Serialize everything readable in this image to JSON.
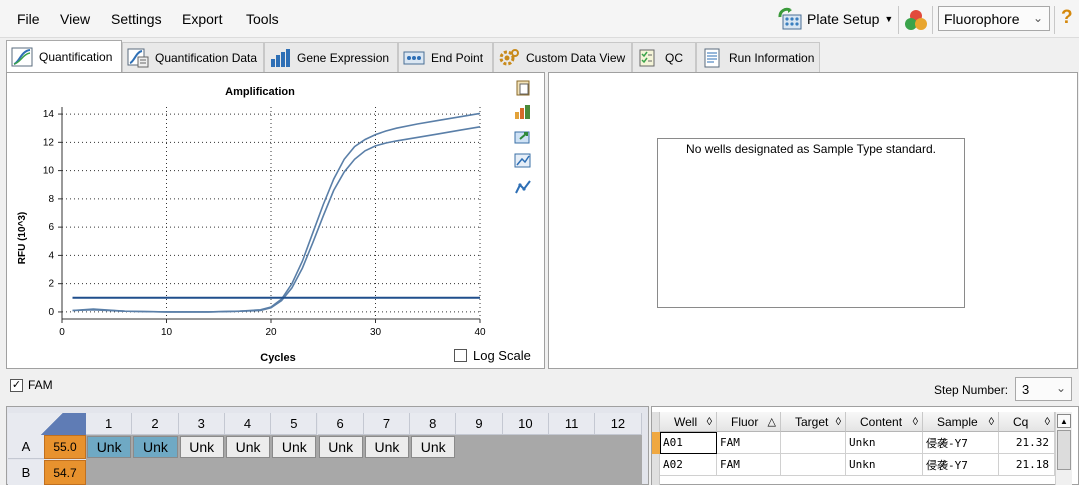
{
  "menu": {
    "file": "File",
    "view": "View",
    "settings": "Settings",
    "export": "Export",
    "tools": "Tools"
  },
  "toolbar": {
    "plate_setup": "Plate Setup",
    "fluorophore": "Fluorophore",
    "help": "?"
  },
  "tabs": [
    "Quantification",
    "Quantification Data",
    "Gene Expression",
    "End Point",
    "Custom Data View",
    "QC",
    "Run Information"
  ],
  "chart_data": {
    "type": "line",
    "title": "Amplification",
    "xlabel": "Cycles",
    "ylabel": "RFU (10^3)",
    "xlim": [
      0,
      40
    ],
    "ylim": [
      -0.5,
      14.5
    ],
    "xticks": [
      0,
      10,
      20,
      30,
      40
    ],
    "yticks": [
      0,
      2,
      4,
      6,
      8,
      10,
      12,
      14
    ],
    "grid": true,
    "series": [
      {
        "x": [
          1,
          3,
          6,
          10,
          14,
          17,
          19,
          20,
          21,
          22,
          23,
          24,
          25,
          26,
          27,
          28,
          29,
          30,
          31,
          32,
          34,
          36,
          38,
          40
        ],
        "y": [
          0.1,
          0.2,
          0.05,
          0,
          0,
          0.05,
          0.15,
          0.35,
          0.9,
          2.0,
          3.6,
          5.6,
          7.6,
          9.4,
          10.8,
          11.7,
          12.2,
          12.55,
          12.8,
          13.0,
          13.3,
          13.55,
          13.8,
          14.05
        ]
      },
      {
        "x": [
          1,
          3,
          6,
          10,
          14,
          17,
          19,
          20,
          21,
          22,
          23,
          24,
          25,
          26,
          27,
          28,
          29,
          30,
          31,
          32,
          34,
          36,
          38,
          40
        ],
        "y": [
          0.1,
          0.15,
          0.05,
          0,
          0,
          0.05,
          0.1,
          0.3,
          0.8,
          1.7,
          3.1,
          4.9,
          6.8,
          8.6,
          9.9,
          10.8,
          11.4,
          11.75,
          11.95,
          12.1,
          12.35,
          12.6,
          12.85,
          13.1
        ]
      },
      {
        "x": [
          1,
          40
        ],
        "y": [
          1.0,
          1.0
        ]
      }
    ]
  },
  "log_scale_label": "Log Scale",
  "std_message": "No wells designated as Sample Type standard.",
  "fam_label": "FAM",
  "step_number_label": "Step Number:",
  "step_number_value": "3",
  "plate": {
    "columns": [
      "1",
      "2",
      "3",
      "4",
      "5",
      "6",
      "7",
      "8",
      "9",
      "10",
      "11",
      "12"
    ],
    "rows": [
      {
        "label": "A",
        "temp": "55.0",
        "wells": [
          "Unk",
          "Unk",
          "Unk",
          "Unk",
          "Unk",
          "Unk",
          "Unk",
          "Unk"
        ]
      },
      {
        "label": "B",
        "temp": "54.7"
      }
    ]
  },
  "results": {
    "headers": [
      "Well",
      "Fluor",
      "Target",
      "Content",
      "Sample",
      "Cq"
    ],
    "rows": [
      [
        "A01",
        "FAM",
        "",
        "Unkn",
        "侵袭-Y7",
        "21.32"
      ],
      [
        "A02",
        "FAM",
        "",
        "Unkn",
        "侵袭-Y7",
        "21.18"
      ]
    ]
  },
  "colors": {
    "curve": "#5a7fa8",
    "threshold": "#1f4e8c",
    "selected_well": "#6fa9c4",
    "temp_orange": "#e8922e"
  }
}
